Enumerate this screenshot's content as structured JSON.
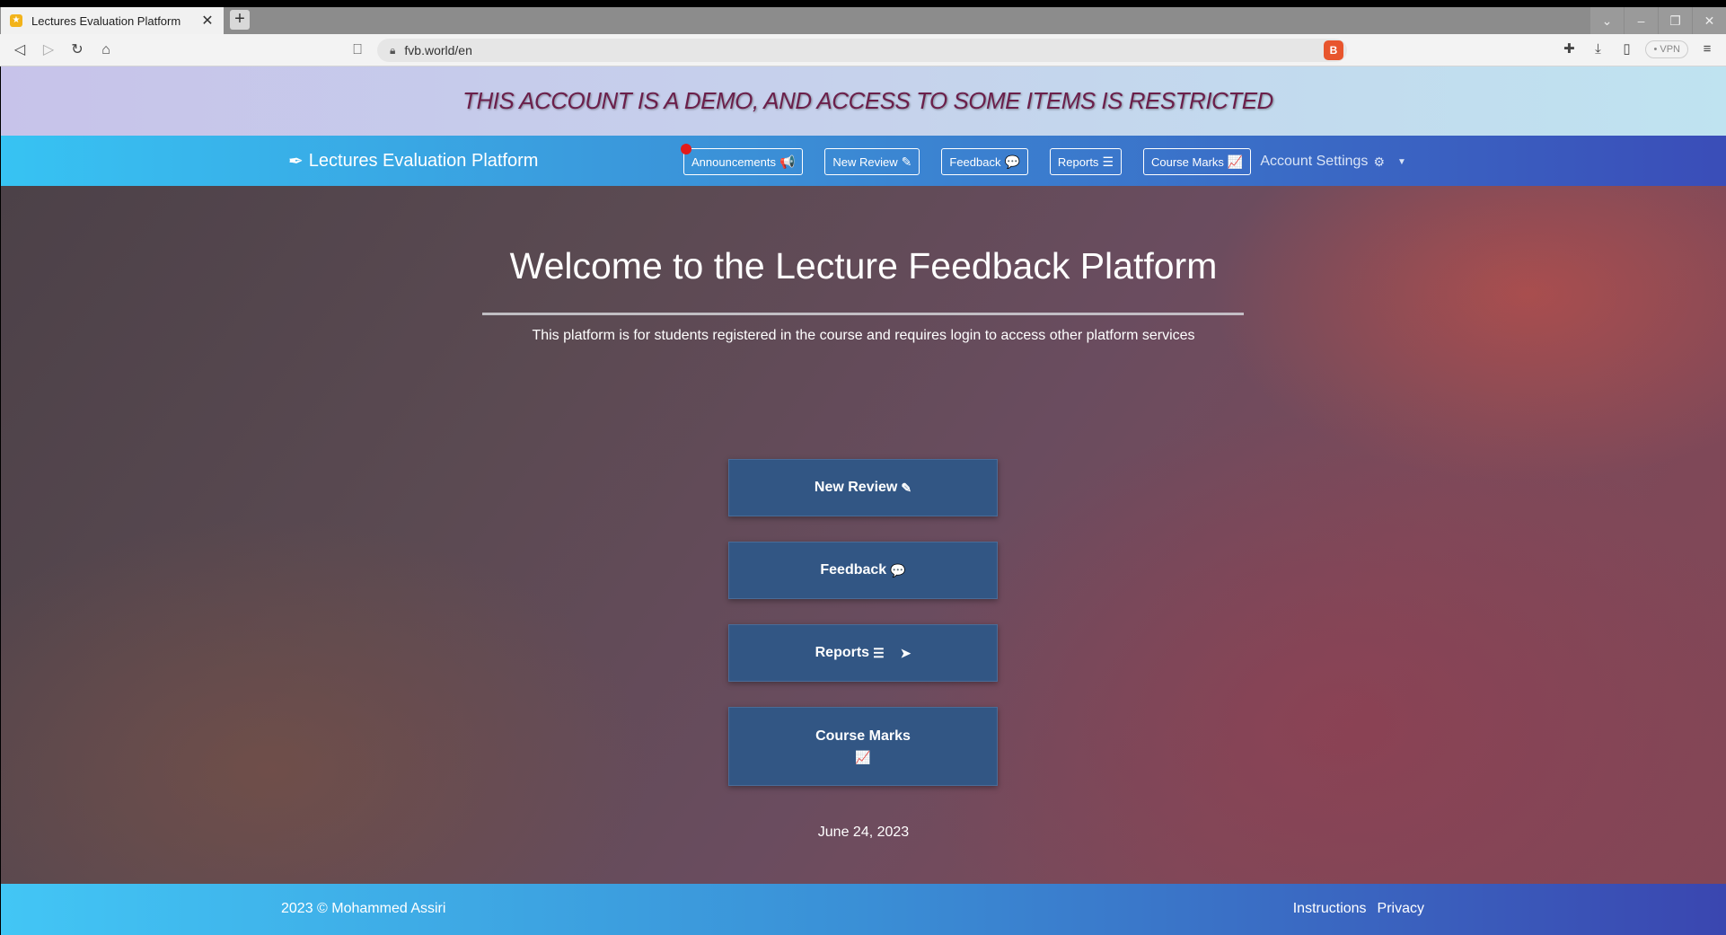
{
  "browser": {
    "tab_title": "Lectures Evaluation Platform",
    "tab_close": "✕",
    "new_tab": "+",
    "url": "fvb.world/en",
    "vpn": "• VPN",
    "win_controls": [
      "⌄",
      "–",
      "❐",
      "✕"
    ]
  },
  "banner": {
    "text": "THIS ACCOUNT IS A DEMO, AND ACCESS TO SOME ITEMS IS RESTRICTED",
    "color": "#6b1f4a"
  },
  "navbar": {
    "brand": "Lectures Evaluation Platform",
    "items": [
      {
        "label": "Announcements",
        "icon": "bullhorn-icon",
        "glyph": "📢"
      },
      {
        "label": "New Review",
        "icon": "edit-icon",
        "glyph": "✎"
      },
      {
        "label": "Feedback",
        "icon": "comments-icon",
        "glyph": "💬"
      },
      {
        "label": "Reports",
        "icon": "list-icon",
        "glyph": "☰"
      },
      {
        "label": "Course Marks",
        "icon": "chart-line-icon",
        "glyph": "📈"
      }
    ],
    "account": "Account Settings",
    "account_glyph": "⚙"
  },
  "hero": {
    "title": "Welcome to the Lecture Feedback Platform",
    "subtitle": "This platform is for students registered in the course and requires login to access other platform services",
    "buttons": {
      "new_review": "New Review",
      "feedback": "Feedback",
      "reports": "Reports",
      "course_marks": "Course Marks"
    },
    "date": "June 24, 2023"
  },
  "footer": {
    "copyright": "2023 © Mohammed Assiri",
    "links": [
      "Instructions",
      "Privacy"
    ]
  },
  "colors": {
    "nav_start": "#37c3f3",
    "nav_end": "#3a4db8",
    "button_bg": "#325684",
    "notification": "#e31a1a"
  }
}
